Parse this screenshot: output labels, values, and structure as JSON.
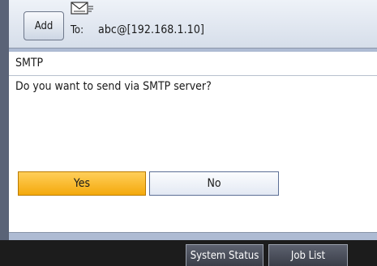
{
  "header": {
    "add_label": "Add",
    "to_label": "To:",
    "to_address": "abc@[192.168.1.10]",
    "envelope_icon": "envelope-icon"
  },
  "dialog": {
    "title": "SMTP",
    "question": "Do you want to send via SMTP server?",
    "yes_label": "Yes",
    "no_label": "No"
  },
  "statusbar": {
    "system_status_label": "System Status",
    "job_list_label": "Job List"
  },
  "colors": {
    "accent_yes": "#f4a90c",
    "panel": "#aebbd3",
    "statusbar": "#1c1c1c"
  }
}
